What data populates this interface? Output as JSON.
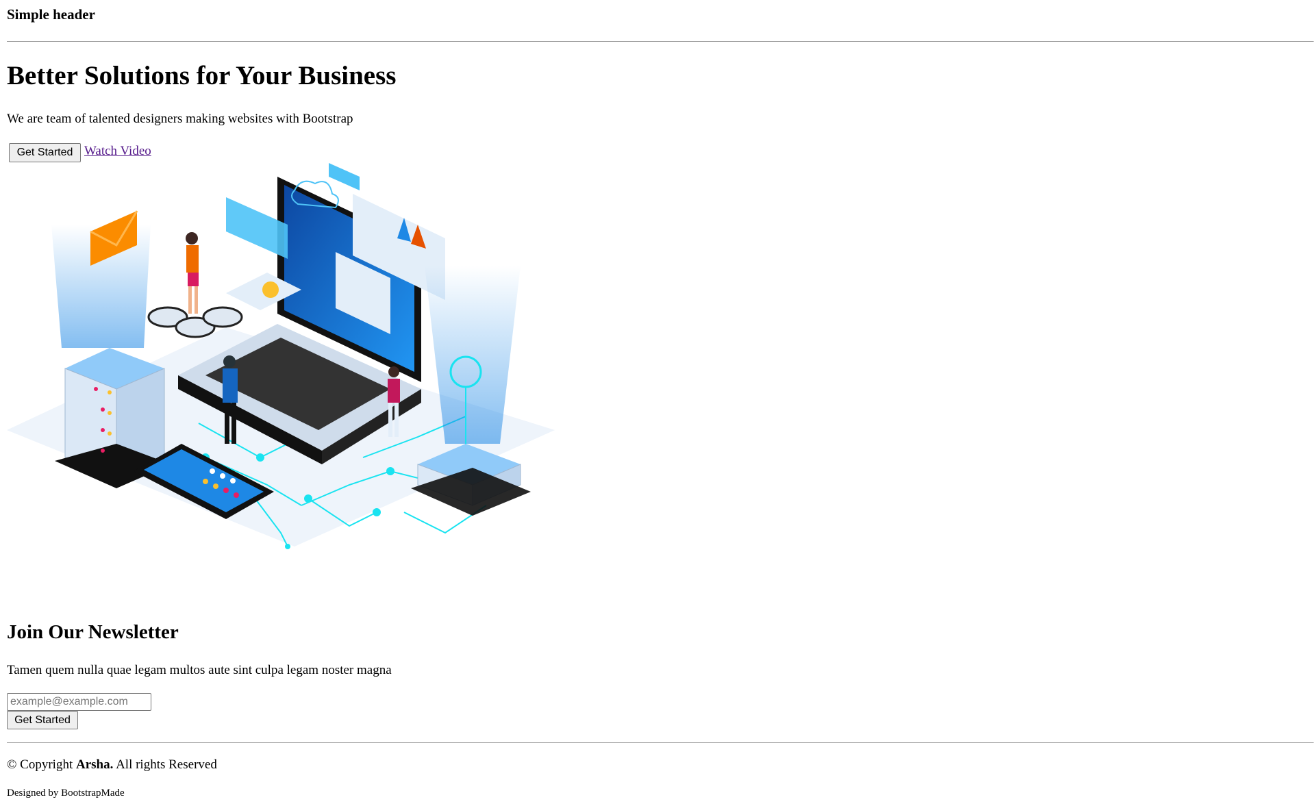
{
  "header": {
    "title": "Simple header"
  },
  "hero": {
    "title": "Better Solutions for Your Business",
    "subtitle": "We are team of talented designers making websites with Bootstrap",
    "primary_button": "Get Started",
    "video_link": "Watch Video"
  },
  "newsletter": {
    "title": "Join Our Newsletter",
    "text": "Tamen quem nulla quae legam multos aute sint culpa legam noster magna",
    "email_placeholder": "example@example.com",
    "button": "Get Started"
  },
  "footer": {
    "copyright_prefix": "© Copyright",
    "brand": "Arsha.",
    "copyright_suffix": "All rights Reserved",
    "credits": "Designed by BootstrapMade"
  },
  "colors": {
    "link_visited": "#551a8b",
    "button_bg": "#efefef",
    "rule": "#9a9a9a",
    "illustration_accent": "#1e88e5"
  }
}
